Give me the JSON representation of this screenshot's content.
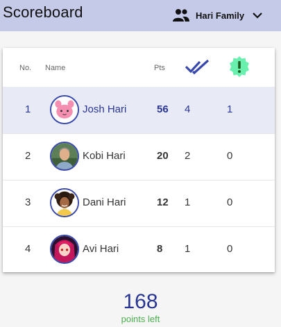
{
  "header": {
    "title": "Scoreboard",
    "family_label": "Hari Family",
    "family_icon": "group-icon",
    "dropdown_icon": "chevron-down-icon"
  },
  "table": {
    "columns": {
      "no": "No.",
      "name": "Name",
      "pts": "Pts",
      "completed_icon": "double-check-icon",
      "alerts_icon": "alert-badge-icon"
    },
    "rows": [
      {
        "no": "1",
        "name": "Josh Hari",
        "pts": "56",
        "completed": "4",
        "alerts": "1",
        "avatar": "pink-creature-avatar",
        "highlighted": true
      },
      {
        "no": "2",
        "name": "Kobi Hari",
        "pts": "20",
        "completed": "2",
        "alerts": "0",
        "avatar": "man-photo-avatar",
        "highlighted": false
      },
      {
        "no": "3",
        "name": "Dani Hari",
        "pts": "12",
        "completed": "1",
        "alerts": "0",
        "avatar": "curly-hair-avatar",
        "highlighted": false
      },
      {
        "no": "4",
        "name": "Avi Hari",
        "pts": "8",
        "completed": "1",
        "alerts": "0",
        "avatar": "anime-girl-avatar",
        "highlighted": false
      }
    ]
  },
  "footer": {
    "points": "168",
    "label": "points left"
  },
  "colors": {
    "header_bg": "#c5cae9",
    "accent": "#3949ab",
    "highlight_row": "#e8eaf6",
    "alert_green": "#69f0ae",
    "points_left_green": "#4caf50"
  }
}
